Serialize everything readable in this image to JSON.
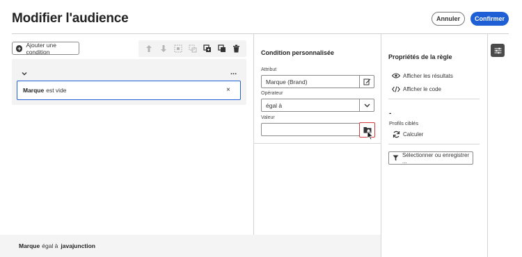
{
  "header": {
    "title": "Modifier l'audience",
    "cancel_label": "Annuler",
    "confirm_label": "Confirmer"
  },
  "left": {
    "add_condition_label": "Ajouter une condition",
    "more_label": "...",
    "condition": {
      "attribute": "Marque",
      "text": "est vide",
      "remove_label": "×"
    }
  },
  "summary": {
    "attribute": "Marque",
    "operator": "égal à",
    "value": "javajunction"
  },
  "condition_panel": {
    "title": "Condition personnalisée",
    "attribute_label": "Attribut",
    "attribute_value": "Marque (Brand)",
    "operator_label": "Opérateur",
    "operator_value": "égal à",
    "value_label": "Valeur",
    "value_value": ""
  },
  "rule_properties": {
    "title": "Propriétés de la règle",
    "show_results_label": "Afficher les résultats",
    "show_code_label": "Afficher le code",
    "count_value": "-",
    "targeted_profiles_label": "Profils ciblés",
    "calculate_label": "Calculer",
    "select_save_label": "Sélectionner ou enregistrer ..."
  },
  "colors": {
    "accent": "#1e5fd6",
    "highlight": "#d63b3b",
    "panel_bg": "#f3f3f3"
  }
}
